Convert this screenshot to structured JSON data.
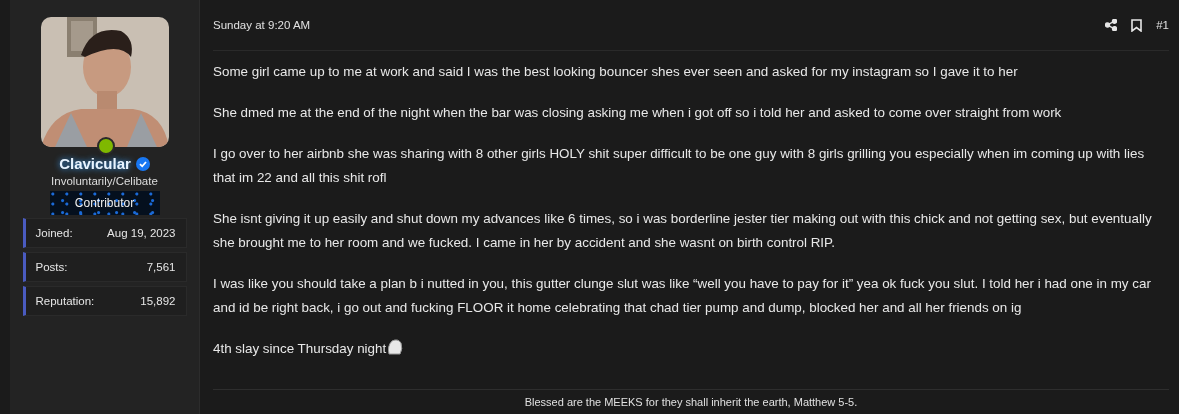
{
  "author": {
    "name": "Clavicular",
    "verified": true,
    "online": true,
    "title": "Involuntarily/Celibate",
    "banner": "Contributor",
    "stats": [
      {
        "label": "Joined:",
        "value": "Aug 19, 2023"
      },
      {
        "label": "Posts:",
        "value": "7,561"
      },
      {
        "label": "Reputation:",
        "value": "15,892"
      }
    ]
  },
  "post": {
    "date": "Sunday at 9:20 AM",
    "number": "#1",
    "paragraphs": [
      {
        "text": "Some girl came up to me at work and said I was the best looking bouncer shes ever seen and asked for my instagram so I gave it to her",
        "sticker": false
      },
      {
        "text": "She dmed me at the end of the night when the bar was closing asking me when i got off so i told her and asked to come over straight from work",
        "sticker": false
      },
      {
        "text": "I go over to her airbnb she was sharing with 8 other girls HOLY shit super difficult to be one guy with 8 girls grilling you especially when im coming up with lies that im 22 and all this shit rofl",
        "sticker": false
      },
      {
        "text": "She isnt giving it up easily and shut down my advances like 6 times, so i was borderline jester tier making out with this chick and not getting sex, but eventually she brought me to her room and we fucked. I came in her by accident and she wasnt on birth control RIP.",
        "sticker": false
      },
      {
        "text": "I was like you should take a plan b i nutted in you, this gutter clunge slut was like “well you have to pay for it” yea ok fuck you slut. I told her i had one in my car and id be right back, i go out and fucking FLOOR it home celebrating that chad tier pump and dump, blocked her and all her friends on ig",
        "sticker": false
      },
      {
        "text": "4th slay since Thursday night",
        "sticker": true
      }
    ],
    "signature": "Blessed are the MEEKS for they shall inherit the earth, Matthew 5-5."
  }
}
